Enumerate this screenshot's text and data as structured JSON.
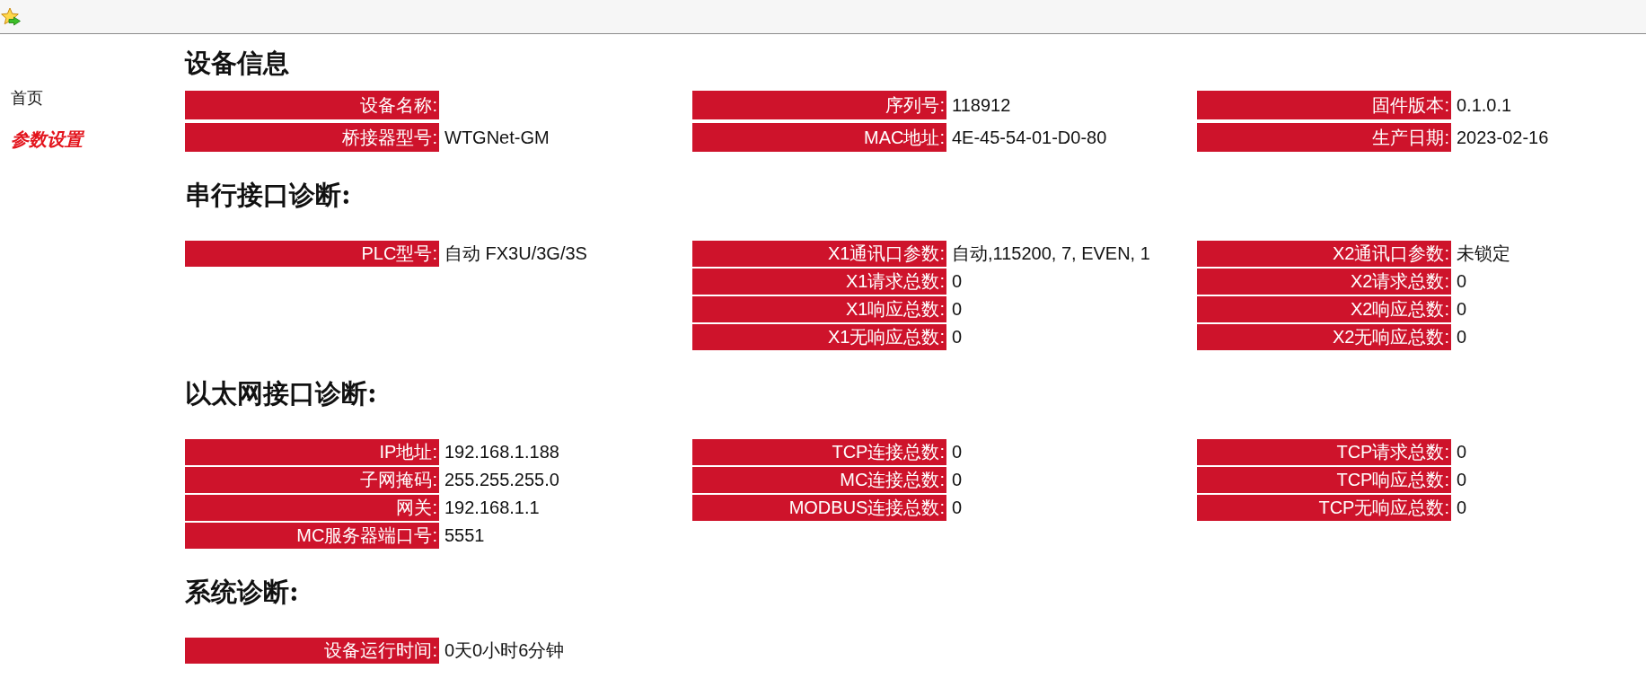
{
  "sidebar": {
    "items": [
      {
        "label": "首页",
        "selected": false
      },
      {
        "label": "参数设置",
        "selected": true
      }
    ]
  },
  "sections": [
    {
      "title": "设备信息",
      "columns": [
        [
          {
            "label": "设备名称:"
          },
          {
            "label": "桥接器型号:",
            "value": "WTGNet-GM"
          }
        ],
        [
          {
            "label": "序列号:",
            "value": "118912"
          },
          {
            "label": "MAC地址:",
            "value": "4E-45-54-01-D0-80"
          }
        ],
        [
          {
            "label": "固件版本:",
            "value": "0.1.0.1"
          },
          {
            "label": "生产日期:",
            "value": "2023-02-16"
          }
        ]
      ]
    },
    {
      "title": "串行接口诊断:",
      "columns": [
        [
          {
            "label": "PLC型号:",
            "value": "自动 FX3U/3G/3S"
          }
        ],
        [
          {
            "label": "X1通讯口参数:",
            "value": "自动,115200, 7, EVEN, 1"
          },
          {
            "label": "X1请求总数:",
            "value": "0"
          },
          {
            "label": "X1响应总数:",
            "value": "0"
          },
          {
            "label": "X1无响应总数:",
            "value": "0"
          }
        ],
        [
          {
            "label": "X2通讯口参数:",
            "value": "未锁定"
          },
          {
            "label": "X2请求总数:",
            "value": "0"
          },
          {
            "label": "X2响应总数:",
            "value": "0"
          },
          {
            "label": "X2无响应总数:",
            "value": "0"
          }
        ]
      ]
    },
    {
      "title": "以太网接口诊断:",
      "columns": [
        [
          {
            "label": "IP地址:",
            "value": "192.168.1.188"
          },
          {
            "label": "子网掩码:",
            "value": "255.255.255.0"
          },
          {
            "label": "网关:",
            "value": "192.168.1.1"
          },
          {
            "label": "MC服务器端口号:",
            "value": "5551"
          }
        ],
        [
          {
            "label": "TCP连接总数:",
            "value": "0"
          },
          {
            "label": "MC连接总数:",
            "value": "0"
          },
          {
            "label": "MODBUS连接总数:",
            "value": "0"
          }
        ],
        [
          {
            "label": "TCP请求总数:",
            "value": "0"
          },
          {
            "label": "TCP响应总数:",
            "value": "0"
          },
          {
            "label": "TCP无响应总数:",
            "value": "0"
          }
        ]
      ]
    },
    {
      "title": "系统诊断:",
      "columns": [
        [
          {
            "label": "设备运行时间:",
            "value": "0天0小时6分钟"
          }
        ]
      ]
    }
  ]
}
